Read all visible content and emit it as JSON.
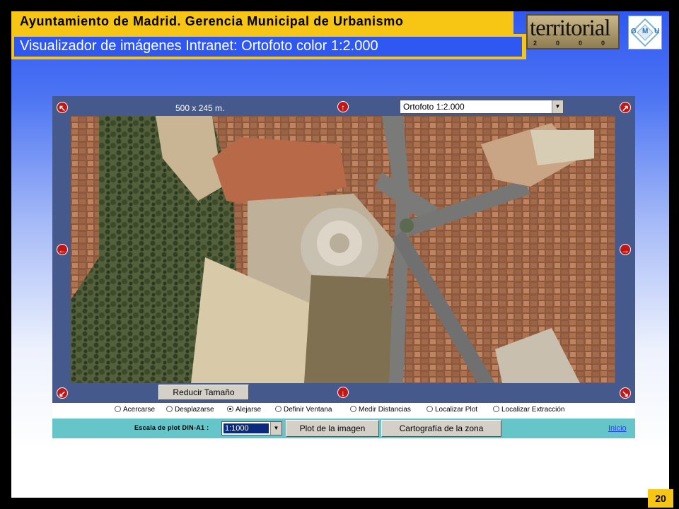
{
  "header": {
    "title": "Ayuntamiento de Madrid. Gerencia Municipal de Urbanismo",
    "subtitle": "Visualizador de imágenes Intranet: Ortofoto color 1:2.000",
    "logo_territorial": "territorial",
    "logo_territorial_year": "2000",
    "logo_gmu": [
      "G",
      "M",
      "U"
    ]
  },
  "viewer": {
    "dimensions": "500 x 245 m.",
    "layer_selected": "Ortofoto 1:2.000",
    "reduce_button": "Reducir Tamaño",
    "pan_arrow_color": "#c41414",
    "tools": [
      {
        "label": "Acercarse",
        "selected": false
      },
      {
        "label": "Desplazarse",
        "selected": false
      },
      {
        "label": "Alejarse",
        "selected": true
      },
      {
        "label": "Definir Ventana",
        "selected": false
      },
      {
        "label": "Medir Distancias",
        "selected": false
      },
      {
        "label": "Localizar Plot",
        "selected": false
      },
      {
        "label": "Localizar Extracción",
        "selected": false
      }
    ],
    "scale_label": "Escala de plot DIN-A1 :",
    "scale_selected": "1:1000",
    "plot_button": "Plot de la imagen",
    "carto_button": "Cartografía de la zona",
    "inicio_link": "Inicio"
  },
  "page_number": "20"
}
